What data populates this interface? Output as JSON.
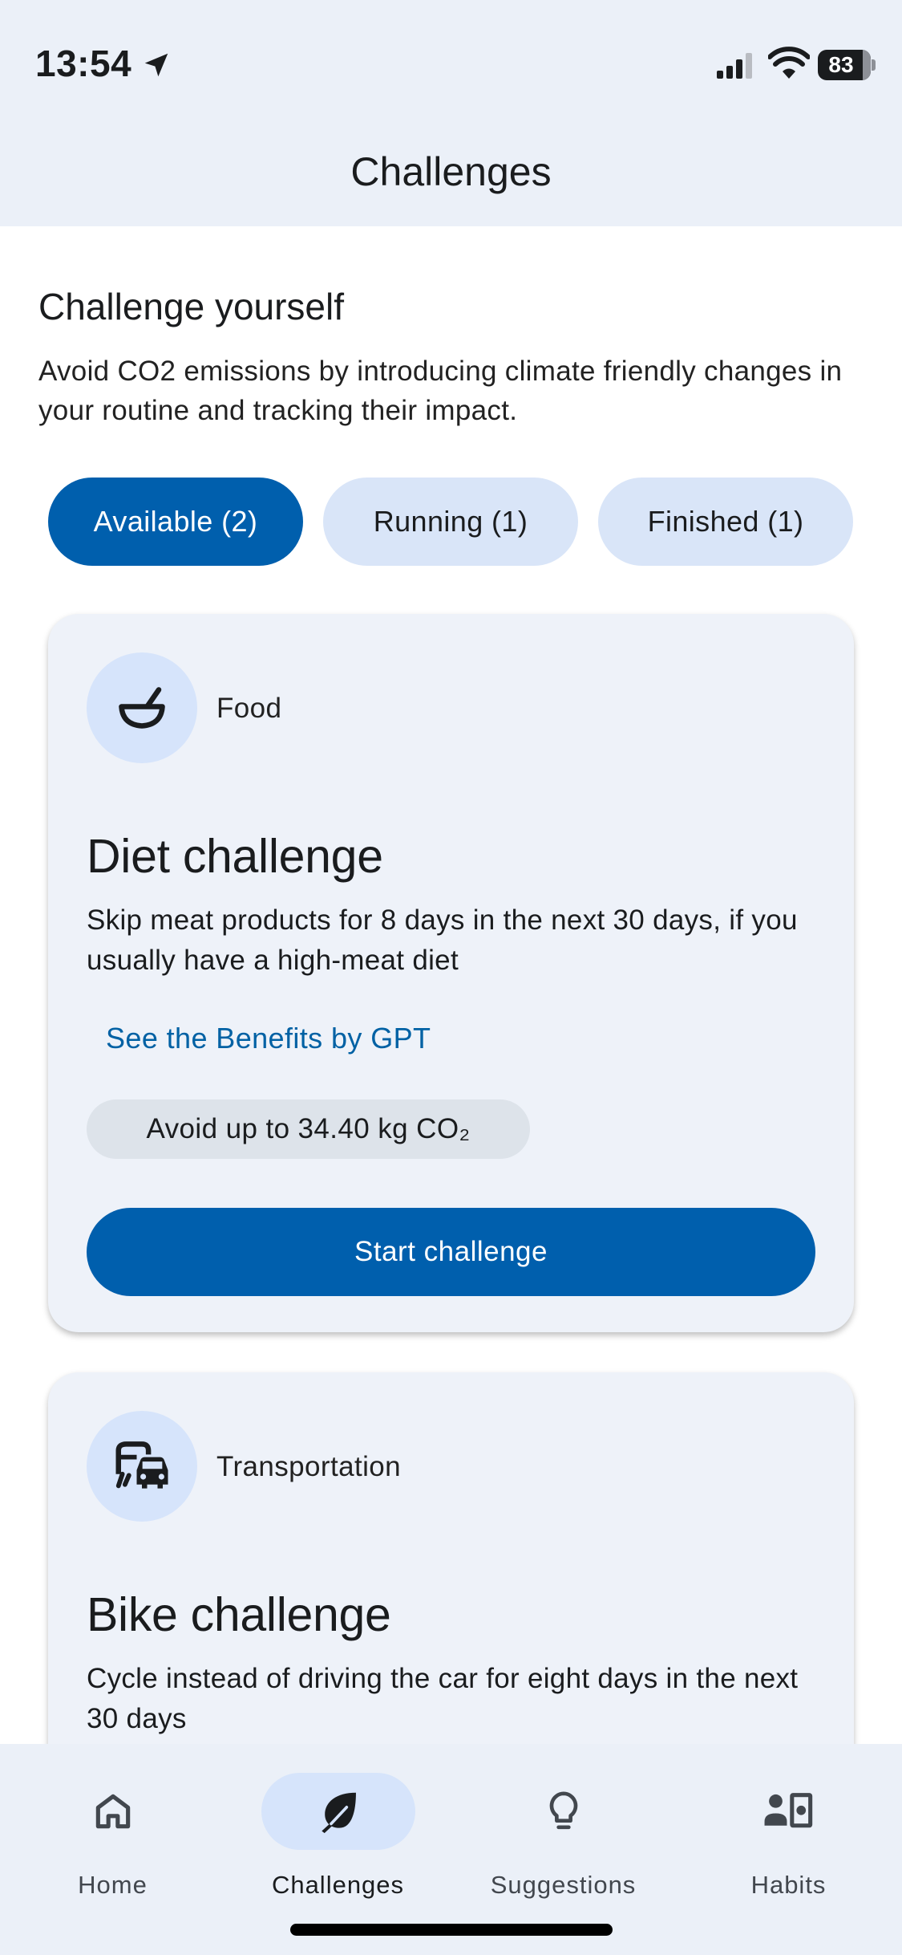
{
  "status_bar": {
    "time": "13:54",
    "battery": "83"
  },
  "header": {
    "title": "Challenges"
  },
  "intro": {
    "title": "Challenge yourself",
    "description": "Avoid CO2 emissions by introducing climate friendly changes in your routine and tracking their impact."
  },
  "tabs": [
    {
      "label": "Available (2)",
      "active": true
    },
    {
      "label": "Running (1)",
      "active": false
    },
    {
      "label": "Finished (1)",
      "active": false
    }
  ],
  "cards": [
    {
      "category": "Food",
      "category_icon": "bowl-icon",
      "title": "Diet challenge",
      "description": "Skip meat products for 8 days in the next 30 days, if you usually have a high-meat diet",
      "link": "See the Benefits by GPT",
      "co2": "Avoid up to 34.40 kg CO₂",
      "button": "Start challenge"
    },
    {
      "category": "Transportation",
      "category_icon": "commute-icon",
      "title": "Bike challenge",
      "description": "Cycle instead of driving the car for eight days in the next 30 days"
    }
  ],
  "nav": [
    {
      "label": "Home",
      "icon": "home-icon",
      "active": false
    },
    {
      "label": "Challenges",
      "icon": "leaf-icon",
      "active": true
    },
    {
      "label": "Suggestions",
      "icon": "lightbulb-icon",
      "active": false
    },
    {
      "label": "Habits",
      "icon": "habits-icon",
      "active": false
    }
  ],
  "colors": {
    "primary": "#005fad",
    "surface": "#eef2f9",
    "chip": "#d9e5f8",
    "bar": "#ebf0f8"
  }
}
